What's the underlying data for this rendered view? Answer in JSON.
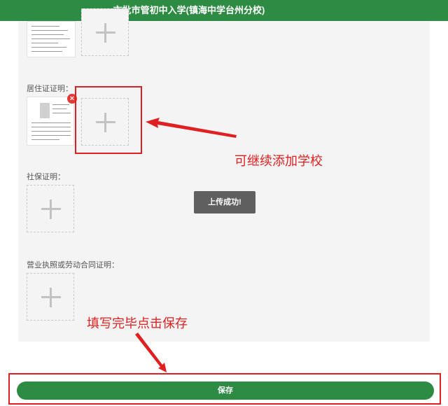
{
  "header": {
    "title": "市批市管初中入学(镇海中学台州分校)"
  },
  "sections": {
    "residence": {
      "label": "居住证证明："
    },
    "social_security": {
      "label": "社保证明："
    },
    "business_license": {
      "label": "营业执照或劳动合同证明："
    }
  },
  "upload": {
    "add_icon": "plus-icon",
    "remove_icon": "close-icon",
    "remove_glyph": "×"
  },
  "toast": {
    "message": "上传成功!"
  },
  "annotations": {
    "continue_add": "可继续添加学校",
    "fill_and_save": "填写完毕点击保存"
  },
  "footer": {
    "save_label": "保存"
  },
  "colors": {
    "brand_green": "#2e8b43",
    "annotation_red": "#e02020",
    "remove_red": "#e53935",
    "toast_bg": "#5f5f5f"
  }
}
